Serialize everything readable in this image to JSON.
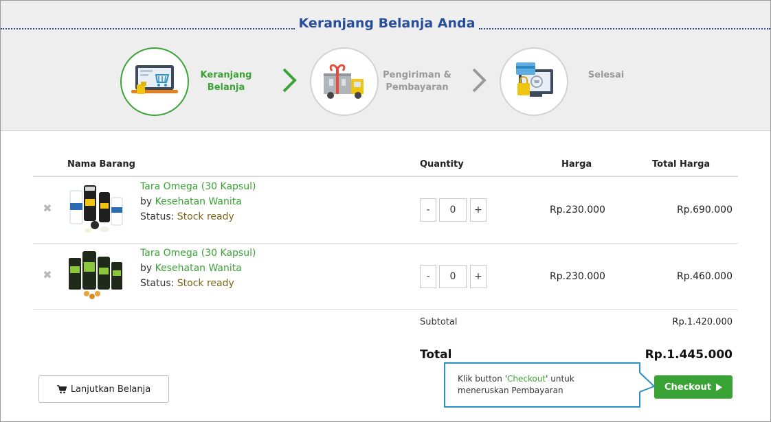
{
  "header": {
    "title": "Keranjang Belanja Anda",
    "steps": [
      {
        "label_line1": "Keranjang",
        "label_line2": "Belanja",
        "icon": "laptop-cart-icon",
        "active": true
      },
      {
        "label_line1": "Pengiriman &",
        "label_line2": "Pembayaran",
        "icon": "delivery-truck-icon",
        "active": false
      },
      {
        "label_line1": "Selesai",
        "label_line2": "",
        "icon": "payment-monitor-icon",
        "active": false
      }
    ]
  },
  "table": {
    "columns": [
      "Nama Barang",
      "Quantity",
      "Harga",
      "Total Harga"
    ],
    "rows": [
      {
        "product_name": "Tara Omega (30 Kapsul)",
        "by_prefix": "by",
        "brand": "Kesehatan Wanita",
        "status_prefix": "Status:",
        "status": "Stock ready",
        "qty_minus": "-",
        "qty": "0",
        "qty_plus": "+",
        "price": "Rp.230.000",
        "total": "Rp.690.000"
      },
      {
        "product_name": "Tara Omega (30 Kapsul)",
        "by_prefix": "by",
        "brand": "Kesehatan Wanita",
        "status_prefix": "Status:",
        "status": "Stock ready",
        "qty_minus": "-",
        "qty": "0",
        "qty_plus": "+",
        "price": "Rp.230.000",
        "total": "Rp.460.000"
      }
    ]
  },
  "summary": {
    "subtotal_label": "Subtotal",
    "subtotal_value": "Rp.1.420.000",
    "total_label": "Total",
    "total_value": "Rp.1.445.000"
  },
  "actions": {
    "continue_label": "Lanjutkan Belanja",
    "checkout_label": "Checkout"
  },
  "callout": {
    "line1_prefix": "Klik button '",
    "line1_highlight": "Checkout",
    "line1_suffix": "' untuk",
    "line2": "meneruskan Pembayaran"
  },
  "colors": {
    "brand_green": "#3aa335",
    "title_blue": "#2a4f9a",
    "callout_blue": "#2b8fc4",
    "stock_brown": "#7a6417"
  }
}
